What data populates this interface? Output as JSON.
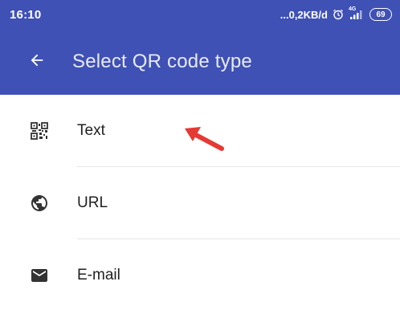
{
  "status_bar": {
    "time": "16:10",
    "network_speed": "...0,2KB/d",
    "network_type": "4G",
    "battery": "69"
  },
  "toolbar": {
    "title": "Select QR code type",
    "back_icon": "arrow-back-icon"
  },
  "list": {
    "items": [
      {
        "label": "Text",
        "icon": "qr-code-icon"
      },
      {
        "label": "URL",
        "icon": "globe-icon"
      },
      {
        "label": "E-mail",
        "icon": "envelope-icon"
      }
    ]
  },
  "colors": {
    "primary": "#3f51b5",
    "text": "#212121",
    "icon": "#333333",
    "divider": "#e6e6e6",
    "annotation": "#e53935"
  }
}
